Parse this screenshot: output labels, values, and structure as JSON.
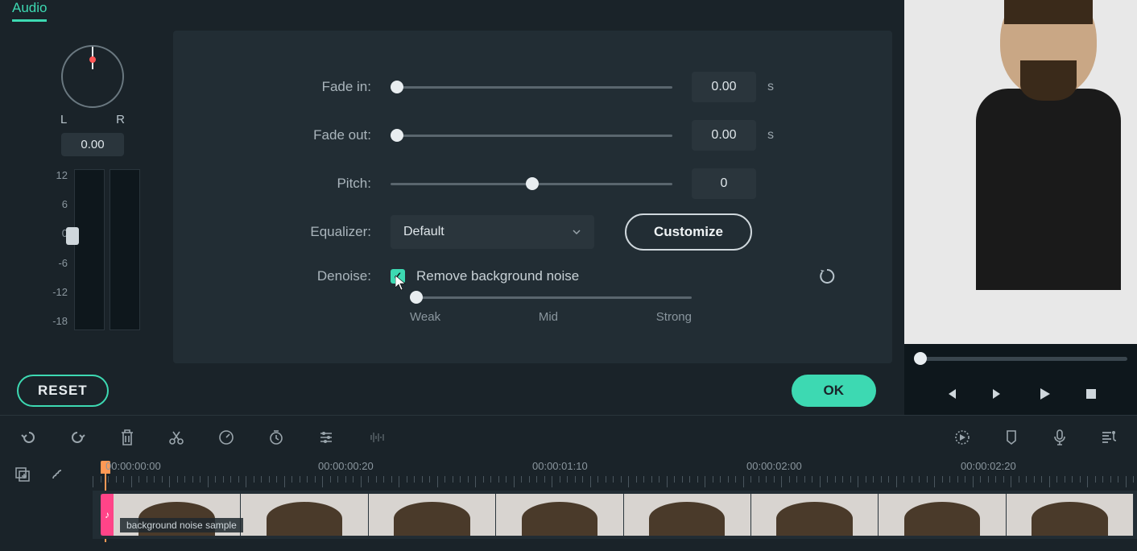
{
  "tab": {
    "label": "Audio"
  },
  "pan": {
    "l": "L",
    "r": "R",
    "value": "0.00"
  },
  "vu_scale": [
    "12",
    "6",
    "0",
    "-6",
    "-12",
    "-18"
  ],
  "controls": {
    "fade_in": {
      "label": "Fade in:",
      "value": "0.00",
      "unit": "s"
    },
    "fade_out": {
      "label": "Fade out:",
      "value": "0.00",
      "unit": "s"
    },
    "pitch": {
      "label": "Pitch:",
      "value": "0"
    },
    "equalizer": {
      "label": "Equalizer:",
      "selected": "Default",
      "customize": "Customize"
    },
    "denoise": {
      "label": "Denoise:",
      "checkbox_label": "Remove background noise",
      "marks": {
        "weak": "Weak",
        "mid": "Mid",
        "strong": "Strong"
      }
    }
  },
  "buttons": {
    "reset": "RESET",
    "ok": "OK"
  },
  "timeline": {
    "timestamps": [
      "00:00:00:00",
      "00:00:00:20",
      "00:00:01:10",
      "00:00:02:00",
      "00:00:02:20"
    ],
    "clip_label": "background noise sample"
  }
}
